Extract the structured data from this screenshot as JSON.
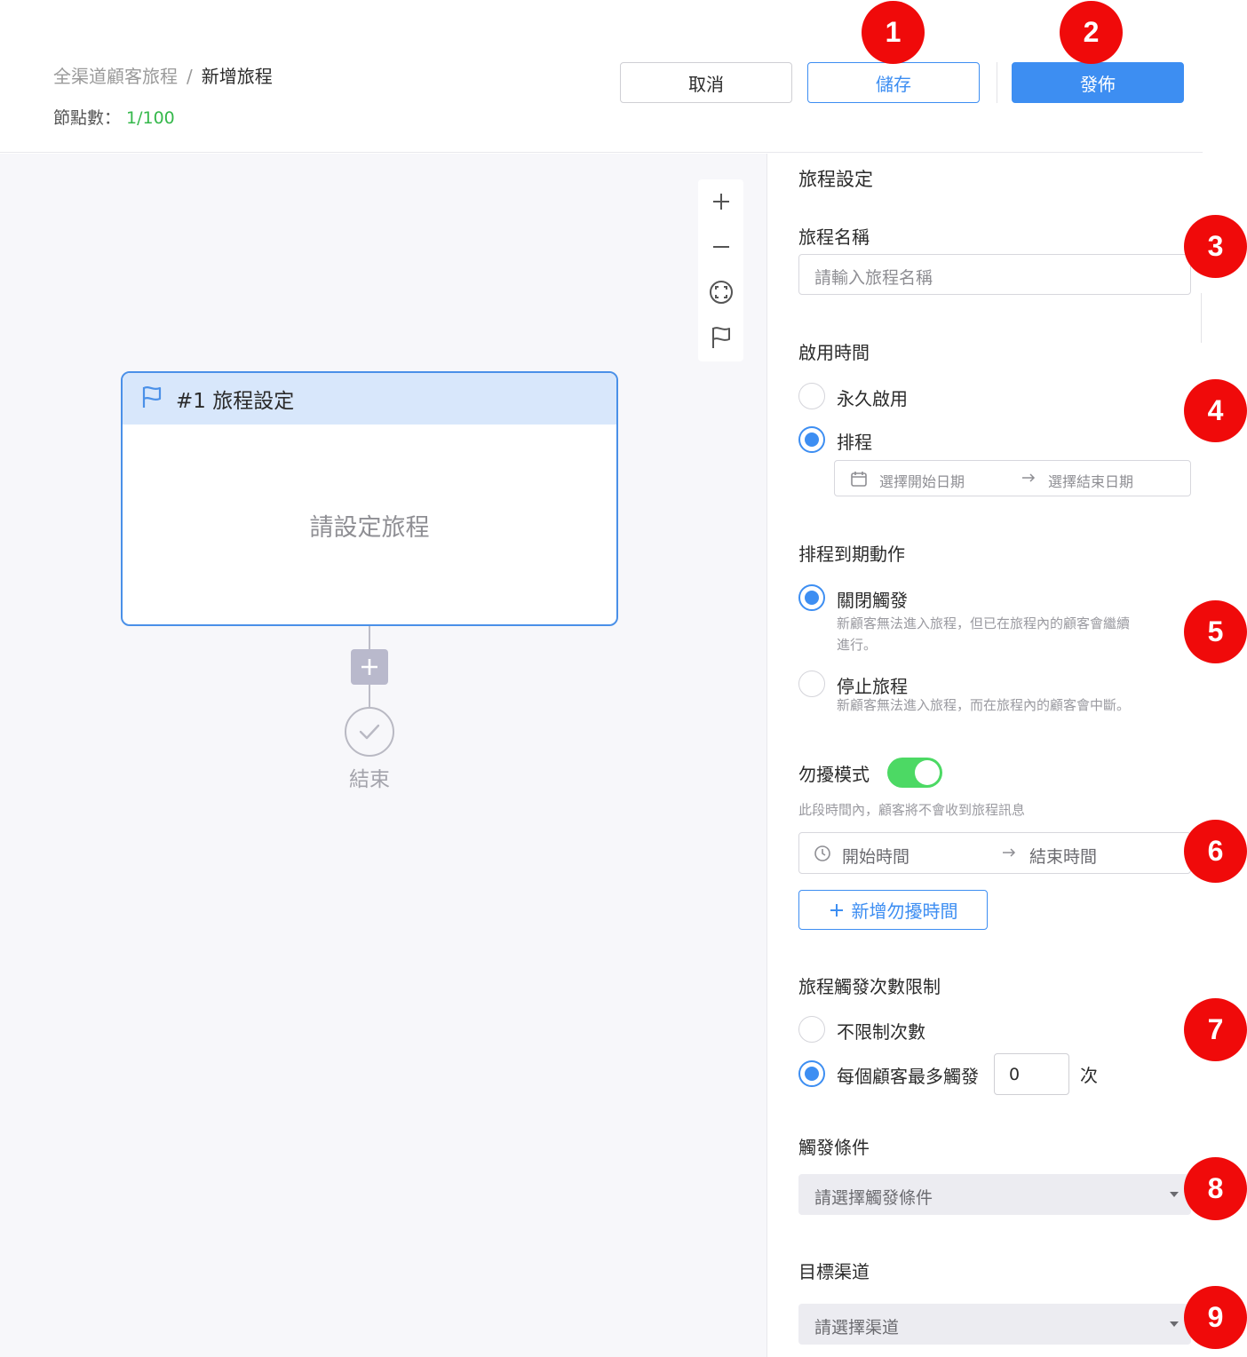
{
  "header": {
    "breadcrumb_root": "全渠道顧客旅程",
    "breadcrumb_sep": "/",
    "breadcrumb_current": "新增旅程",
    "node_count_label": "節點數：",
    "node_count_value": "1/100",
    "cancel_label": "取消",
    "save_label": "儲存",
    "publish_label": "發佈"
  },
  "badges": [
    "1",
    "2",
    "3",
    "4",
    "5",
    "6",
    "7",
    "8",
    "9"
  ],
  "canvas": {
    "zoom_tools": [
      "zoom-in-icon",
      "zoom-out-icon",
      "fit-view-icon",
      "flag-icon"
    ],
    "card_title": "#1 旅程設定",
    "card_placeholder": "請設定旅程",
    "end_label": "結束"
  },
  "panel": {
    "title": "旅程設定",
    "name": {
      "label": "旅程名稱",
      "placeholder": "請輸入旅程名稱"
    },
    "active_time": {
      "label": "啟用時間",
      "options": [
        "永久啟用",
        "排程"
      ],
      "selected": "排程",
      "start_placeholder": "選擇開始日期",
      "end_placeholder": "選擇結束日期"
    },
    "expiry_action": {
      "label": "排程到期動作",
      "options": [
        {
          "label": "關閉觸發",
          "hint_line1": "新顧客無法進入旅程，但已在旅程內的顧客會繼續",
          "hint_line2": "進行。"
        },
        {
          "label": "停止旅程",
          "hint_line1": "新顧客無法進入旅程，而在旅程內的顧客會中斷。"
        }
      ],
      "selected": "關閉觸發"
    },
    "dnd": {
      "label": "勿擾模式",
      "enabled": true,
      "hint": "此段時間內，顧客將不會收到旅程訊息",
      "start_placeholder": "開始時間",
      "end_placeholder": "結束時間",
      "add_label": "新增勿擾時間"
    },
    "trigger_limit": {
      "label": "旅程觸發次數限制",
      "options": [
        "不限制次數",
        "每個顧客最多觸發"
      ],
      "selected": "每個顧客最多觸發",
      "count_value": "0",
      "unit": "次"
    },
    "trigger_condition": {
      "label": "觸發條件",
      "placeholder": "請選擇觸發條件"
    },
    "target_channel": {
      "label": "目標渠道",
      "placeholder": "請選擇渠道"
    }
  },
  "colors": {
    "primary": "#3d8ef2",
    "badge": "#f00a0a",
    "toggle_on": "#4cd964",
    "node_count": "#35b84b"
  }
}
